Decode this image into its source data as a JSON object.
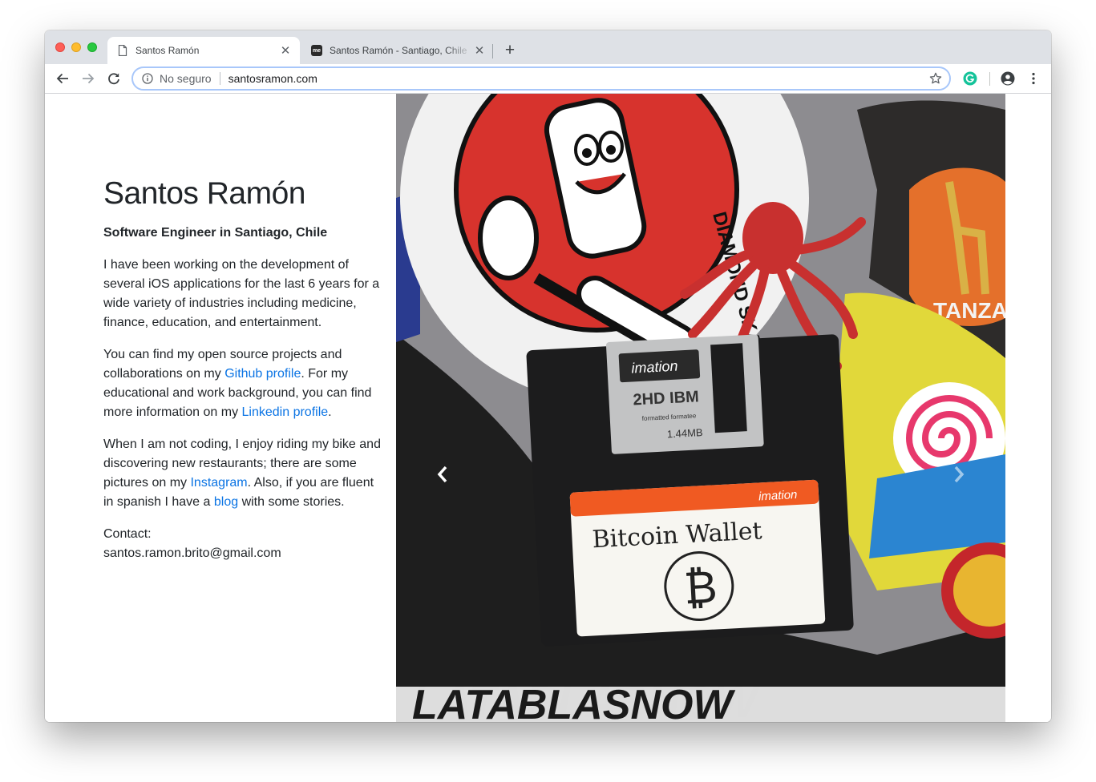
{
  "browser": {
    "tabs": [
      {
        "title": "Santos Ramón",
        "active": true,
        "icon": "document-icon"
      },
      {
        "title": "Santos Ramón - Santiago, Chile",
        "active": false,
        "icon": "about-me-favicon",
        "favicon_text": "me"
      }
    ],
    "new_tab_symbol": "+",
    "close_symbol": "✕",
    "address_bar": {
      "security_label": "No seguro",
      "url": "santosramon.com"
    },
    "extension_icon_color": "#15c39a"
  },
  "page": {
    "name": "Santos Ramón",
    "subtitle": "Software Engineer in Santiago, Chile",
    "paragraph1": "I have been working on the development of several iOS applications for the last 6 years for a wide variety of industries including medicine, finance, education, and entertainment.",
    "paragraph2": {
      "before_github": "You can find my open source projects and collaborations on my ",
      "github_link": "Github profile",
      "between": ". For my educational and work background, you can find more information on my ",
      "linkedin_link": "Linkedin profile",
      "after": "."
    },
    "paragraph3": {
      "before_instagram": "When I am not coding, I enjoy riding my bike and discovering new restaurants; there are some pictures on my ",
      "instagram_link": "Instagram",
      "between": ". Also, if you are fluent in spanish I have a ",
      "blog_link": "blog",
      "after": " with some stories."
    },
    "contact_label": "Contact:",
    "contact_email": "santos.ramon.brito@gmail.com",
    "link_color": "#0b74e4"
  },
  "carousel": {
    "image_texts": {
      "diskette_brand": "imation",
      "diskette_type": "2HD IBM",
      "diskette_formatted": "formatted formatee",
      "diskette_capacity": "1.44MB",
      "label_brand": "imation",
      "handwritten_label": "Bitcoin Wallet",
      "sticker_brand": "DIAMOND SKATE",
      "sticker_bottom": "LATABLASNOW",
      "sticker_tanzania": "TANZA"
    }
  }
}
